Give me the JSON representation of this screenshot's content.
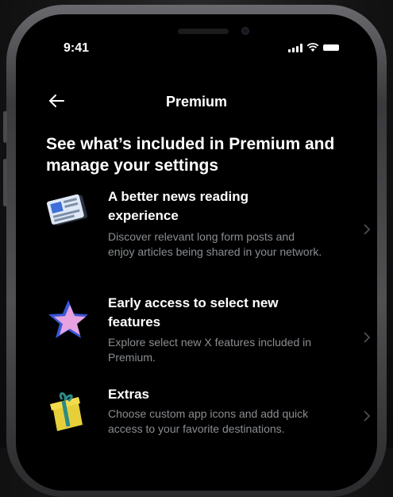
{
  "status_bar": {
    "time": "9:41"
  },
  "header": {
    "title": "Premium"
  },
  "headline": "See what’s included in Premium and manage your settings",
  "features": [
    {
      "title": "A better news reading experience",
      "description": "Discover relevant long form posts and enjoy articles being shared in your network.",
      "icon": "newspaper-icon"
    },
    {
      "title": "Early access to select new features",
      "description": "Explore select new X features included in Premium.",
      "icon": "star-icon"
    },
    {
      "title": "Extras",
      "description": "Choose custom app icons and add quick access to your favorite destinations.",
      "icon": "gift-icon"
    }
  ],
  "colors": {
    "background": "#000000",
    "text": "#ffffff",
    "secondary_text": "#8a8d91"
  }
}
